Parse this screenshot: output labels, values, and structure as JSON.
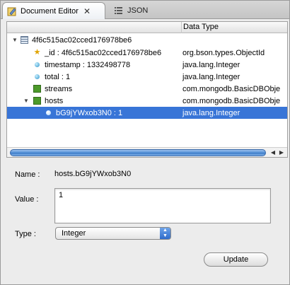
{
  "tabs": [
    {
      "label": "Document Editor",
      "close": "✕",
      "icon": "document-editor-icon"
    },
    {
      "label": "JSON",
      "icon": "json-list-icon"
    }
  ],
  "tree": {
    "columns": [
      "",
      "Data Type"
    ],
    "rows": [
      {
        "name": "4f6c515ac02cced176978be6",
        "type": "",
        "icon": "document-icon",
        "expanded": true
      },
      {
        "name": "_id : 4f6c515ac02cced176978be6",
        "type": "org.bson.types.ObjectId",
        "icon": "key-star-icon"
      },
      {
        "name": "timestamp : 1332498778",
        "type": "java.lang.Integer",
        "icon": "field-dot-icon"
      },
      {
        "name": "total : 1",
        "type": "java.lang.Integer",
        "icon": "field-dot-icon"
      },
      {
        "name": "streams",
        "type": "com.mongodb.BasicDBObje",
        "icon": "object-square-icon"
      },
      {
        "name": "hosts",
        "type": "com.mongodb.BasicDBObje",
        "icon": "object-square-icon",
        "expanded": true
      },
      {
        "name": "bG9jYWxob3N0 : 1",
        "type": "java.lang.Integer",
        "icon": "field-dot-icon",
        "selected": true
      }
    ]
  },
  "detail": {
    "name_label": "Name :",
    "name_value": "hosts.bG9jYWxob3N0",
    "value_label": "Value :",
    "value": "1",
    "type_label": "Type :",
    "type_selected": "Integer",
    "update_label": "Update"
  },
  "colors": {
    "selection": "#3875d7",
    "object_icon": "#4c9a2a"
  }
}
